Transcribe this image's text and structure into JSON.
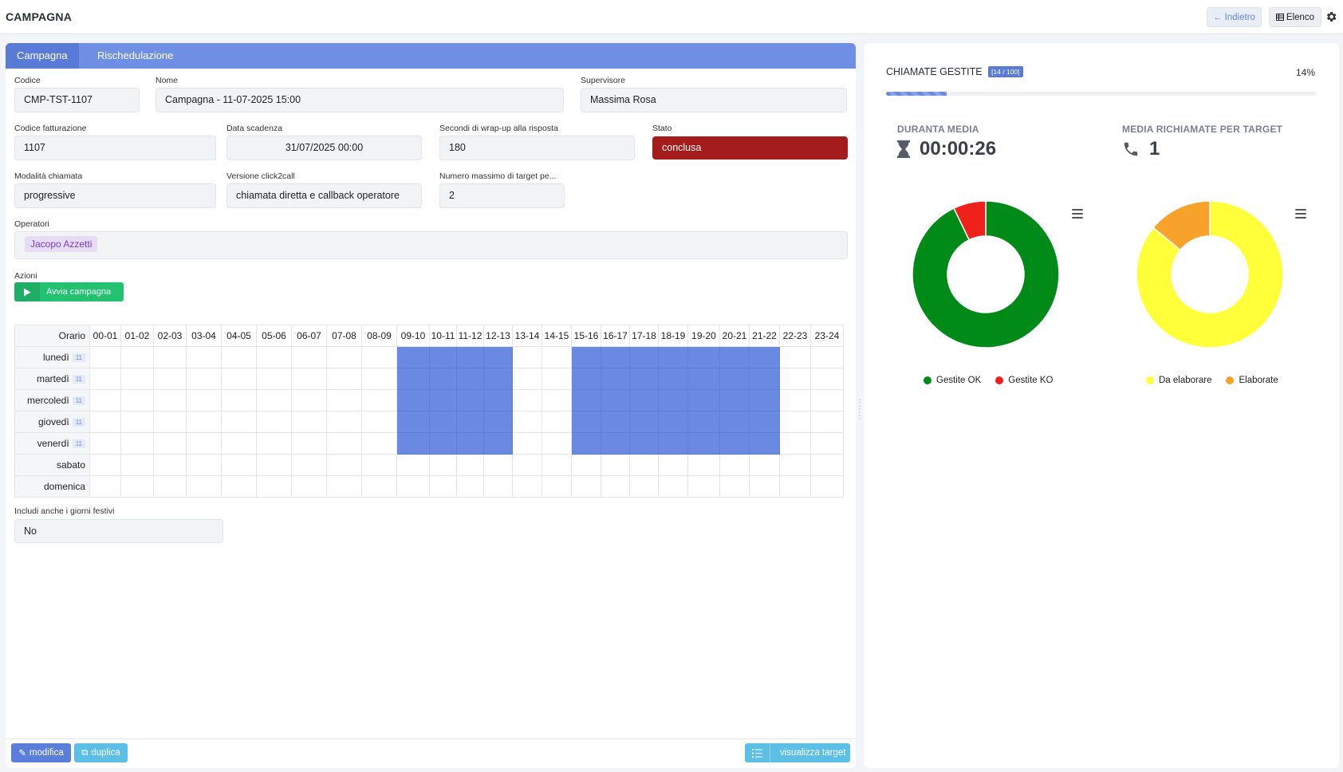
{
  "header": {
    "title": "CAMPAGNA",
    "back_label": "Indietro",
    "list_label": "Elenco"
  },
  "tabs": [
    {
      "label": "Campagna",
      "active": true
    },
    {
      "label": "Rischedulazione",
      "active": false
    }
  ],
  "form": {
    "codice": {
      "label": "Codice",
      "value": "CMP-TST-1107"
    },
    "nome": {
      "label": "Nome",
      "value": "Campagna - 11-07-2025 15:00"
    },
    "supervisore": {
      "label": "Supervisore",
      "value": "Massima Rosa"
    },
    "codice_fatturazione": {
      "label": "Codice fatturazione",
      "value": "1107"
    },
    "data_scadenza": {
      "label": "Data scadenza",
      "value": "31/07/2025 00:00"
    },
    "secondi_wrapup": {
      "label": "Secondi di wrap-up alla risposta",
      "value": "180"
    },
    "stato": {
      "label": "Stato",
      "value": "conclusa",
      "color": "#a51c1c"
    },
    "modalita": {
      "label": "Modalità chiamata",
      "value": "progressive"
    },
    "versione": {
      "label": "Versione click2call",
      "value": "chiamata diretta e callback operatore"
    },
    "numero_max": {
      "label": "Numero massimo di target pe...",
      "value": "2"
    },
    "operatori": {
      "label": "Operatori",
      "chips": [
        "Jacopo Azzetti"
      ]
    },
    "azioni": {
      "label": "Azioni",
      "start_label": "Avvia campagna"
    },
    "festivi": {
      "label": "Includi anche i giorni festivi",
      "value": "No"
    }
  },
  "schedule": {
    "header_label": "Orario",
    "hours": [
      "00-01",
      "01-02",
      "02-03",
      "03-04",
      "04-05",
      "05-06",
      "06-07",
      "07-08",
      "08-09",
      "09-10",
      "10-11",
      "11-12",
      "12-13",
      "13-14",
      "14-15",
      "15-16",
      "16-17",
      "17-18",
      "18-19",
      "19-20",
      "20-21",
      "21-22",
      "22-23",
      "23-24"
    ],
    "days": [
      {
        "name": "lunedì",
        "badge": "11",
        "active": [
          9,
          10,
          11,
          12,
          15,
          16,
          17,
          18,
          19,
          20,
          21
        ]
      },
      {
        "name": "martedì",
        "badge": "11",
        "active": [
          9,
          10,
          11,
          12,
          15,
          16,
          17,
          18,
          19,
          20,
          21
        ]
      },
      {
        "name": "mercoledì",
        "badge": "11",
        "active": [
          9,
          10,
          11,
          12,
          15,
          16,
          17,
          18,
          19,
          20,
          21
        ]
      },
      {
        "name": "giovedì",
        "badge": "11",
        "active": [
          9,
          10,
          11,
          12,
          15,
          16,
          17,
          18,
          19,
          20,
          21
        ]
      },
      {
        "name": "venerdì",
        "badge": "11",
        "active": [
          9,
          10,
          11,
          12,
          15,
          16,
          17,
          18,
          19,
          20,
          21
        ]
      },
      {
        "name": "sabato",
        "badge": "",
        "active": []
      },
      {
        "name": "domenica",
        "badge": "",
        "active": []
      }
    ],
    "on_color": "#6a89e2"
  },
  "footer": {
    "edit_label": "modifica",
    "duplicate_label": "duplica",
    "targets_label": "visualizza target"
  },
  "stats": {
    "title": "CHIAMATE GESTITE",
    "badge": "[14 / 100]",
    "percent_label": "14%",
    "progress": 0.14,
    "avg_duration_label": "DURANTA MEDIA",
    "avg_duration_value": "00:00:26",
    "avg_recall_label": "MEDIA RICHIAMATE PER TARGET",
    "avg_recall_value": "1"
  },
  "chart_data": [
    {
      "type": "pie",
      "categories": [
        "Gestite OK",
        "Gestite KO"
      ],
      "values": [
        13,
        1
      ],
      "colors": [
        "#008a17",
        "#f0201b"
      ],
      "legend": "bottom"
    },
    {
      "type": "pie",
      "categories": [
        "Da elaborare",
        "Elaborate"
      ],
      "values": [
        86,
        14
      ],
      "colors": [
        "#ffff3a",
        "#f7a22a"
      ],
      "legend": "bottom"
    }
  ]
}
